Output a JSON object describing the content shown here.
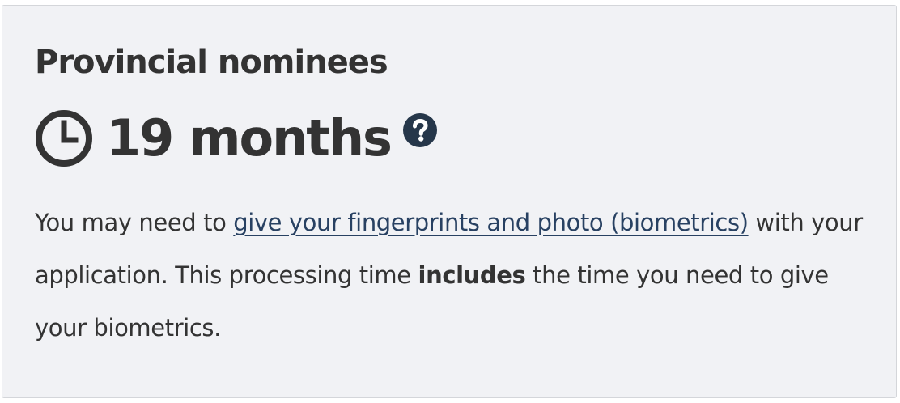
{
  "card": {
    "title": "Provincial nominees",
    "time_value": "19 months",
    "clock_icon": "clock-icon",
    "help_icon": "question-circle-icon",
    "note": {
      "prefix": "You may need to ",
      "link_text": "give your fingerprints and photo (biometrics)",
      "line2_before": " with your application. This processing time ",
      "emphasis": "includes",
      "suffix": " the time you need to give your biometrics."
    }
  },
  "colors": {
    "card_background": "#f1f2f5",
    "card_border": "#d4d6da",
    "text": "#333333",
    "link": "#284162",
    "help_icon": "#26374a"
  }
}
